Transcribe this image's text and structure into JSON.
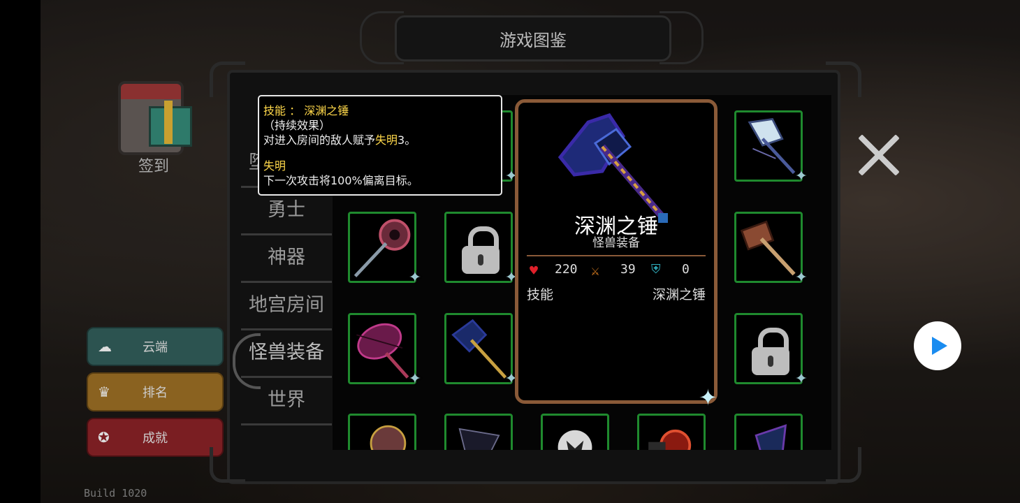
{
  "header": {
    "title": "游戏图鉴"
  },
  "left_menu": {
    "signin_label": "签到",
    "cloud_label": "云端",
    "rank_label": "排名",
    "achievement_label": "成就",
    "build_text": "Build 1020"
  },
  "categories": [
    {
      "label": "堕落勇士"
    },
    {
      "label": "勇士"
    },
    {
      "label": "神器"
    },
    {
      "label": "地宫房间"
    },
    {
      "label": "怪兽装备",
      "selected": true
    },
    {
      "label": "世界"
    }
  ],
  "tooltip": {
    "skill_line_prefix": "技能 ： ",
    "skill_name": "深渊之锤",
    "effect_type": "（持续效果）",
    "desc_prefix": "对进入房间的敌人赋予",
    "desc_keyword": "失明",
    "desc_suffix": "3。",
    "status_name": "失明",
    "status_desc": "下一次攻击将100%偏离目标。"
  },
  "detail": {
    "name": "深渊之锤",
    "category": "怪兽装备",
    "hp": "220",
    "attack": "39",
    "defense": "0",
    "skill_label": "技能",
    "skill_value": "深渊之锤"
  },
  "grid": {
    "slots": [
      {
        "state": "item",
        "icon": "abyss-hammer-shadow-icon"
      },
      {
        "state": "locked"
      },
      {
        "state": "item",
        "icon": "frost-axe-icon"
      },
      {
        "state": "item",
        "icon": "flesh-staff-icon"
      },
      {
        "state": "locked"
      },
      {
        "state": "item",
        "icon": "bone-hammer-icon"
      },
      {
        "state": "item",
        "icon": "spiked-mace-icon"
      },
      {
        "state": "item",
        "icon": "abyss-hammer-icon",
        "selected": true
      },
      {
        "state": "locked"
      },
      {
        "state": "item",
        "icon": "horn-weapon-icon"
      },
      {
        "state": "item",
        "icon": "dark-claw-icon"
      },
      {
        "state": "item",
        "icon": "skull-mask-icon"
      },
      {
        "state": "item",
        "icon": "lava-axe-icon"
      },
      {
        "state": "item",
        "icon": "shadow-blade-icon"
      }
    ]
  },
  "colors": {
    "slot_border": "#1f8a2e",
    "detail_border": "#8a5a38",
    "highlight_text": "#ffd84a",
    "play_button": "#1a8cf0"
  }
}
